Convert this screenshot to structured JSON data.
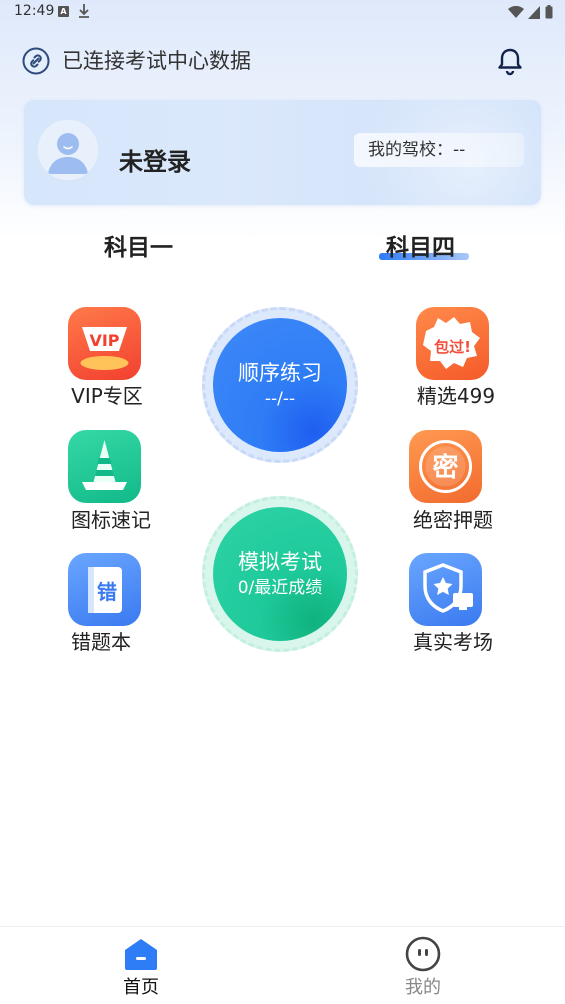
{
  "status_bar": {
    "time": "12:49",
    "a_badge": "A"
  },
  "header": {
    "connection_text": "已连接考试中心数据",
    "icons": [
      "link-icon",
      "bell-icon"
    ]
  },
  "user_card": {
    "login_text": "未登录",
    "school_label": "我的驾校：--"
  },
  "tabs": [
    {
      "label": "科目一",
      "active": false
    },
    {
      "label": "科目四",
      "active": true
    }
  ],
  "grid": {
    "left": [
      {
        "label": "VIP专区",
        "icon_text": "VIP",
        "icon": "vip-icon"
      },
      {
        "label": "图标速记",
        "icon": "traffic-cone-icon"
      },
      {
        "label": "错题本",
        "icon_text": "错",
        "icon": "wrong-book-icon"
      }
    ],
    "right": [
      {
        "label": "精选499",
        "icon_text": "包过!",
        "icon": "guarantee-icon"
      },
      {
        "label": "绝密押题",
        "icon_text": "密",
        "icon": "secret-icon"
      },
      {
        "label": "真实考场",
        "icon": "shield-star-icon"
      }
    ]
  },
  "circles": {
    "practice": {
      "title": "顺序练习",
      "sub": "--/--"
    },
    "mock": {
      "title": "模拟考试",
      "sub": "0/最近成绩"
    }
  },
  "bottom_nav": [
    {
      "label": "首页",
      "active": true
    },
    {
      "label": "我的",
      "active": false
    }
  ],
  "colors": {
    "accent_blue": "#2e7cf6",
    "accent_green": "#1ec99a",
    "vip_red": "#f24f3a"
  }
}
